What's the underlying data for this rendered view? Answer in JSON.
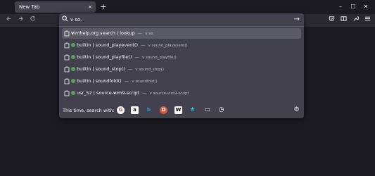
{
  "tabs": [
    {
      "label": "New Tab",
      "close": "×"
    }
  ],
  "new_tab": "+",
  "window_controls": {
    "minimize": "–",
    "maximize": "☐",
    "close": "✕"
  },
  "urlbar": {
    "value": "v so.",
    "go": "→"
  },
  "suggestions": [
    {
      "prefix": "",
      "match": "v",
      "rest": "imhelp.org search / lookup",
      "action": "v so.",
      "dot": false,
      "selected": true
    },
    {
      "name": "builtin | sound_playevent()",
      "action": "v sound_playevent()",
      "dot": true
    },
    {
      "name": "builtin | sound_playfile()",
      "action": "v sound_playfile()",
      "dot": true
    },
    {
      "name": "builtin | sound_stop()",
      "action": "v sound_stop()",
      "dot": true
    },
    {
      "name": "builtin | soundfold()",
      "action": "v soundfold()",
      "dot": true
    },
    {
      "name_pre": "usr_52 | source-",
      "match": "v",
      "name_post": "im9-script",
      "action": "v source-vim9-script",
      "dot": true
    }
  ],
  "search_with_label": "This time, search with:",
  "engines": [
    {
      "name": "google",
      "glyph": "G",
      "color": "#ea4335",
      "bg": "#ffffff"
    },
    {
      "name": "amazon",
      "glyph": "a",
      "color": "#ffffff",
      "bg": "#1c1b22"
    },
    {
      "name": "bing",
      "glyph": "b",
      "color": "#1b9de2",
      "bg": "transparent"
    },
    {
      "name": "duckduckgo",
      "glyph": "D",
      "color": "#ffffff",
      "bg": "#de5833"
    },
    {
      "name": "wikipedia",
      "glyph": "W",
      "color": "#000000",
      "bg": "#ffffff"
    },
    {
      "name": "bookmarks",
      "glyph": "★",
      "color": "#2ac3d9",
      "bg": "transparent"
    },
    {
      "name": "tabs",
      "glyph": "▭",
      "color": "#fbfbfe",
      "bg": "transparent"
    },
    {
      "name": "history",
      "glyph": "◷",
      "color": "#fbfbfe",
      "bg": "transparent"
    }
  ],
  "settings_glyph": "⚙",
  "dash": "—"
}
